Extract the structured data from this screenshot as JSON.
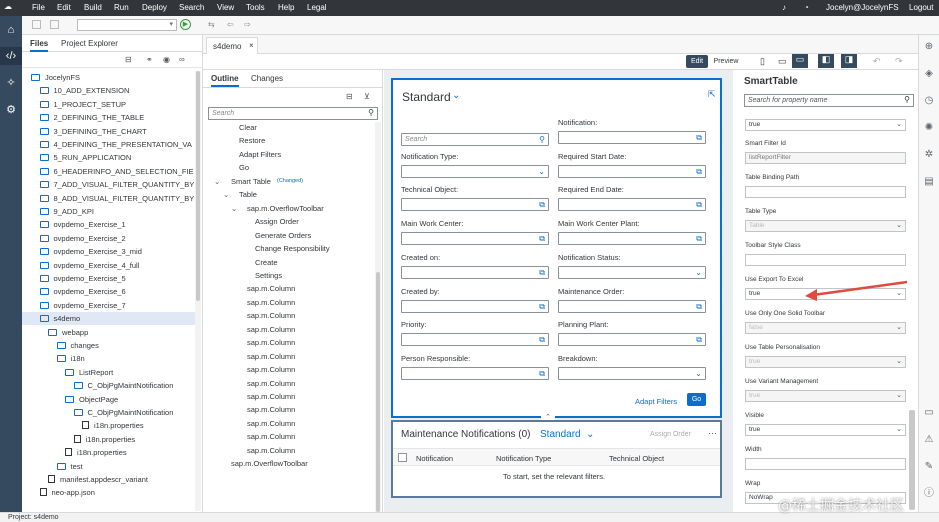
{
  "menu": {
    "items": [
      "File",
      "Edit",
      "Build",
      "Run",
      "Deploy",
      "Search",
      "View",
      "Tools",
      "Help",
      "Legal"
    ],
    "user": "Jocelyn@JocelynFS",
    "logout": "Logout"
  },
  "left_tabs": {
    "files": "Files",
    "project_explorer": "Project Explorer"
  },
  "tree": [
    "JocelynFS",
    "10_ADD_EXTENSION",
    "1_PROJECT_SETUP",
    "2_DEFINING_THE_TABLE",
    "3_DEFINING_THE_CHART",
    "4_DEFINING_THE_PRESENTATION_VA",
    "5_RUN_APPLICATION",
    "6_HEADERINFO_AND_SELECTION_FIE",
    "7_ADD_VISUAL_FILTER_QUANTITY_BY",
    "8_ADD_VISUAL_FILTER_QUANTITY_BY",
    "9_ADD_KPI",
    "ovpdemo_Exercise_1",
    "ovpdemo_Exercise_2",
    "ovpdemo_Exercise_3_mid",
    "ovpdemo_Exercise_4_full",
    "ovpdemo_Exercise_5",
    "ovpdemo_Exercise_6",
    "ovpdemo_Exercise_7",
    "s4demo",
    "webapp",
    "changes",
    "i18n",
    "ListReport",
    "C_ObjPgMaintNotification",
    "ObjectPage",
    "C_ObjPgMaintNotification",
    "i18n.properties",
    "i18n.properties",
    "i18n.properties",
    "test",
    "manifest.appdescr_variant",
    "neo-app.json"
  ],
  "editor_tab": "s4demo",
  "mode": {
    "edit": "Edit",
    "preview": "Preview"
  },
  "outline": {
    "tab_outline": "Outline",
    "tab_changes": "Changes",
    "search_placeholder": "Search",
    "items": [
      "Clear",
      "Restore",
      "Adapt Filters",
      "Go",
      "Smart Table",
      "(Changed)",
      "Table",
      "sap.m.OverflowToolbar",
      "Assign Order",
      "Generate Orders",
      "Change Responsibility",
      "Create",
      "Settings",
      "sap.m.Column",
      "sap.m.Column",
      "sap.m.Column",
      "sap.m.Column",
      "sap.m.Column",
      "sap.m.Column",
      "sap.m.Column",
      "sap.m.Column",
      "sap.m.Column",
      "sap.m.Column",
      "sap.m.Column",
      "sap.m.Column",
      "sap.m.Column",
      "sap.m.OverflowToolbar"
    ]
  },
  "filterbar": {
    "variant": "Standard",
    "search_placeholder": "Search",
    "labels": [
      "Notification:",
      "Notification Type:",
      "Required Start Date:",
      "Technical Object:",
      "Required End Date:",
      "Main Work Center:",
      "Main Work Center Plant:",
      "Created on:",
      "Notification Status:",
      "Created by:",
      "Maintenance Order:",
      "Priority:",
      "Planning Plant:",
      "Person Responsible:",
      "Breakdown:"
    ],
    "adapt_filters": "Adapt Filters",
    "go": "Go"
  },
  "table": {
    "title": "Maintenance Notifications (0)",
    "variant": "Standard",
    "assign_order": "Assign Order",
    "columns": [
      "Notification",
      "Notification Type",
      "Technical Object"
    ],
    "empty": "To start, set the relevant filters."
  },
  "props": {
    "title": "SmartTable",
    "search_placeholder": "Search for property name",
    "rows": [
      {
        "label": "",
        "value": "true"
      },
      {
        "label": "Smart Filter Id",
        "value": "listReportFilter"
      },
      {
        "label": "Table Binding Path",
        "value": ""
      },
      {
        "label": "Table Type",
        "value": "Table"
      },
      {
        "label": "Toolbar Style Class",
        "value": ""
      },
      {
        "label": "Use Export To Excel",
        "value": "true"
      },
      {
        "label": "Use Only One Solid Toolbar",
        "value": "false"
      },
      {
        "label": "Use Table Personalisation",
        "value": "true"
      },
      {
        "label": "Use Variant Management",
        "value": "true"
      },
      {
        "label": "Visible",
        "value": "true"
      },
      {
        "label": "Width",
        "value": ""
      },
      {
        "label": "Wrap",
        "value": "NoWrap"
      }
    ]
  },
  "status": {
    "project": "Project:  s4demo"
  },
  "watermark": "@稀土掘金技术社区",
  "colors": {
    "menubar": "#32363a",
    "shell": "#354a5f",
    "accent": "#0a6ed1",
    "arrow": "#e04a3f"
  }
}
